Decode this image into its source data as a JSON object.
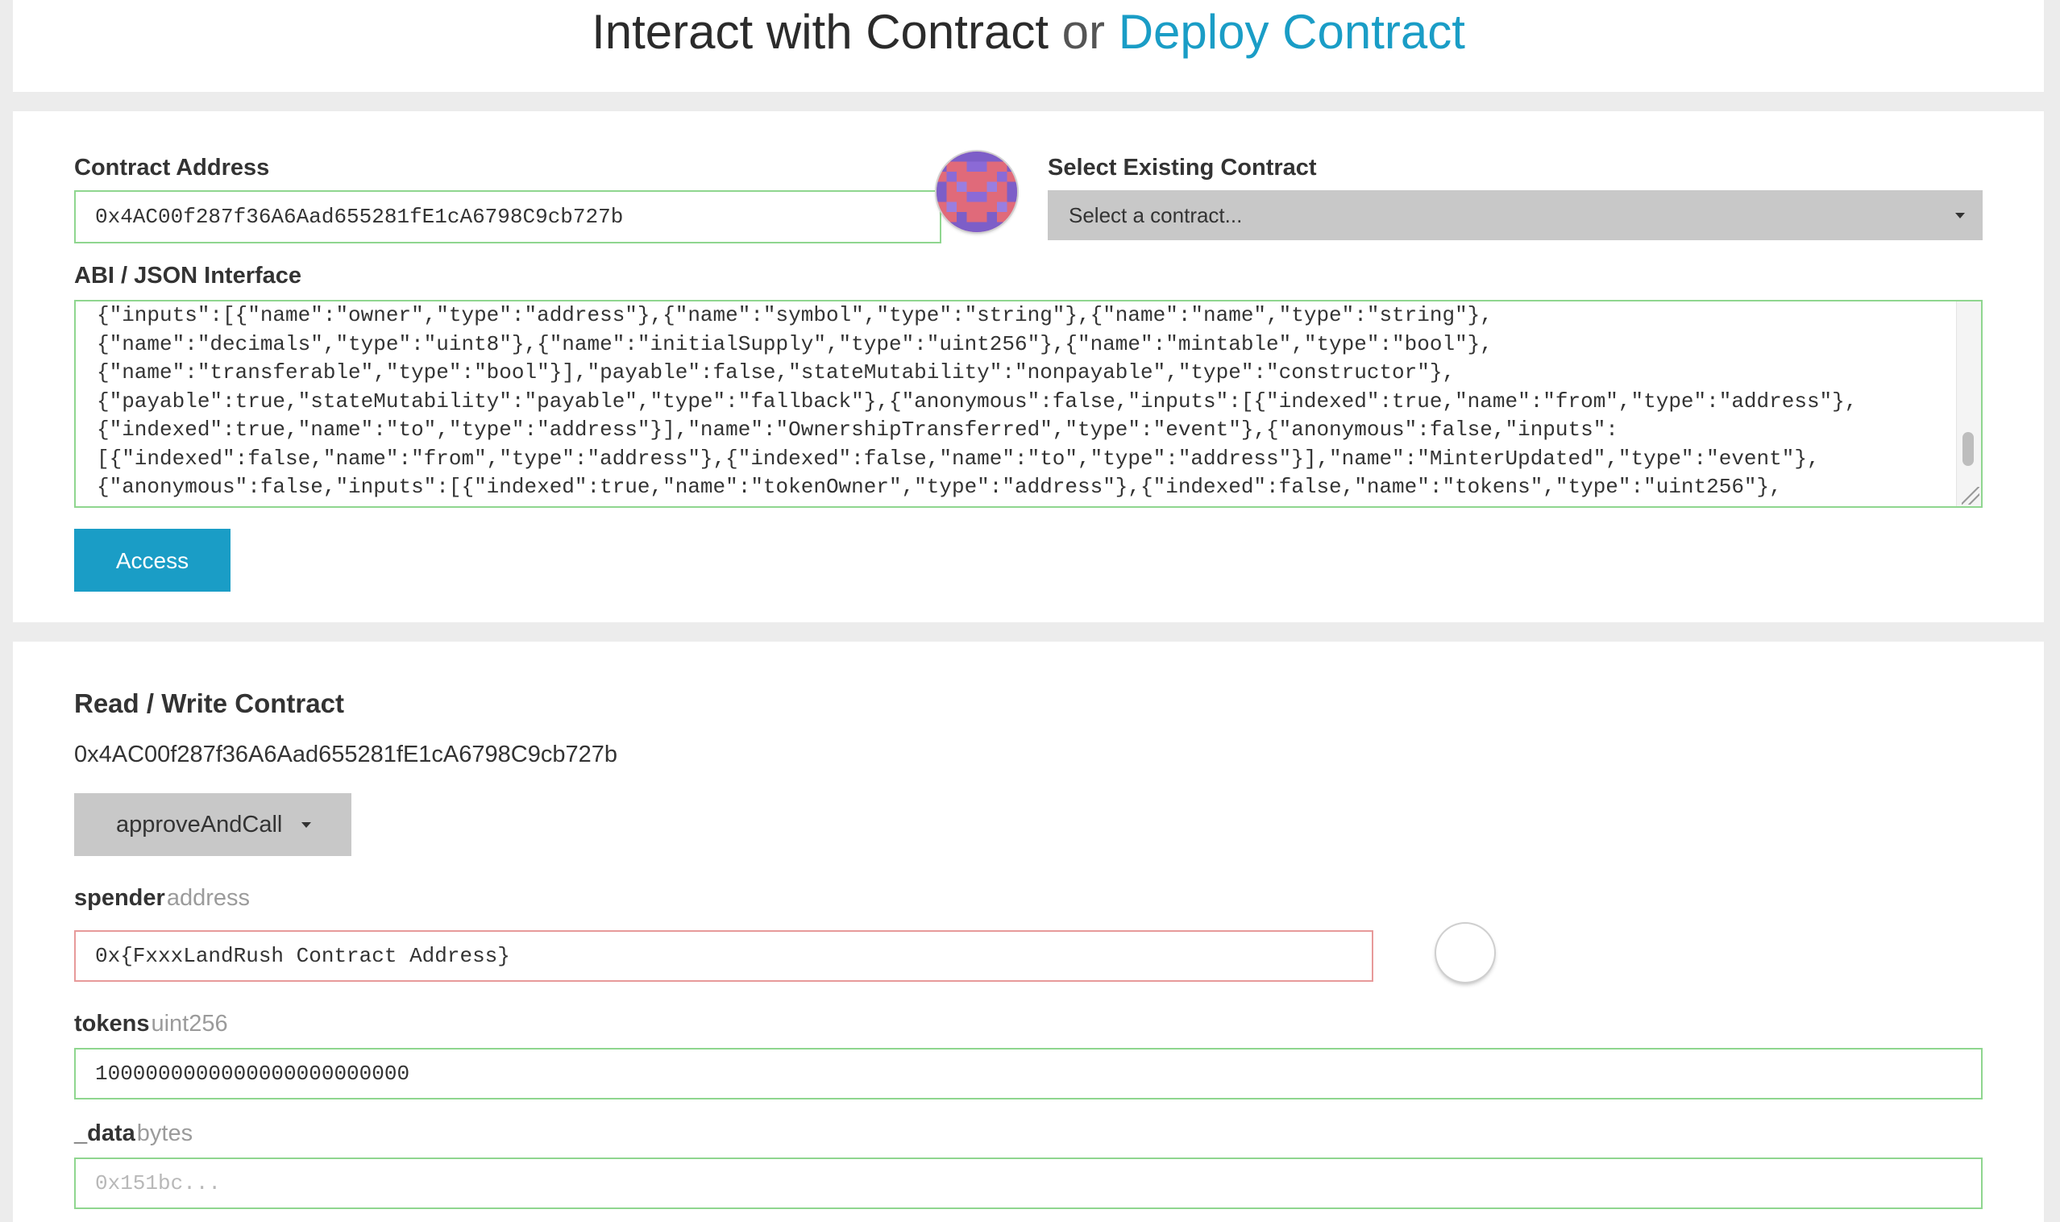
{
  "header": {
    "interact_label": "Interact with Contract",
    "or_label": "or",
    "deploy_label": "Deploy Contract"
  },
  "contract_form": {
    "address_label": "Contract Address",
    "address_value": "0x4AC00f287f36A6Aad655281fE1cA6798C9cb727b",
    "select_label": "Select Existing Contract",
    "select_value": "Select a contract...",
    "abi_label": "ABI / JSON Interface",
    "abi_lines": [
      "{\"inputs\":[{\"name\":\"owner\",\"type\":\"address\"},{\"name\":\"symbol\",\"type\":\"string\"},{\"name\":\"name\",\"type\":\"string\"},",
      "{\"name\":\"decimals\",\"type\":\"uint8\"},{\"name\":\"initialSupply\",\"type\":\"uint256\"},{\"name\":\"mintable\",\"type\":\"bool\"},",
      "{\"name\":\"transferable\",\"type\":\"bool\"}],\"payable\":false,\"stateMutability\":\"nonpayable\",\"type\":\"constructor\"},",
      "{\"payable\":true,\"stateMutability\":\"payable\",\"type\":\"fallback\"},{\"anonymous\":false,\"inputs\":[{\"indexed\":true,\"name\":\"from\",\"type\":\"address\"},",
      "{\"indexed\":true,\"name\":\"to\",\"type\":\"address\"}],\"name\":\"OwnershipTransferred\",\"type\":\"event\"},{\"anonymous\":false,\"inputs\":",
      "[{\"indexed\":false,\"name\":\"from\",\"type\":\"address\"},{\"indexed\":false,\"name\":\"to\",\"type\":\"address\"}],\"name\":\"MinterUpdated\",\"type\":\"event\"},",
      "{\"anonymous\":false,\"inputs\":[{\"indexed\":true,\"name\":\"tokenOwner\",\"type\":\"address\"},{\"indexed\":false,\"name\":\"tokens\",\"type\":\"uint256\"},"
    ],
    "access_label": "Access"
  },
  "read_write": {
    "title": "Read / Write Contract",
    "address": "0x4AC00f287f36A6Aad655281fE1cA6798C9cb727b",
    "function_selected": "approveAndCall",
    "params": [
      {
        "name": "spender",
        "type": "address",
        "value": "0x{FxxxLandRush Contract Address}",
        "placeholder": ""
      },
      {
        "name": "tokens",
        "type": "uint256",
        "value": "1000000000000000000000000",
        "placeholder": ""
      },
      {
        "name": "_data",
        "type": "bytes",
        "value": "",
        "placeholder": "0x151bc..."
      }
    ]
  },
  "colors": {
    "accent": "#1a9dc6",
    "valid_border": "#8fd68f",
    "error_border": "#e79a9a",
    "dropdown_bg": "#c8c8c8"
  }
}
